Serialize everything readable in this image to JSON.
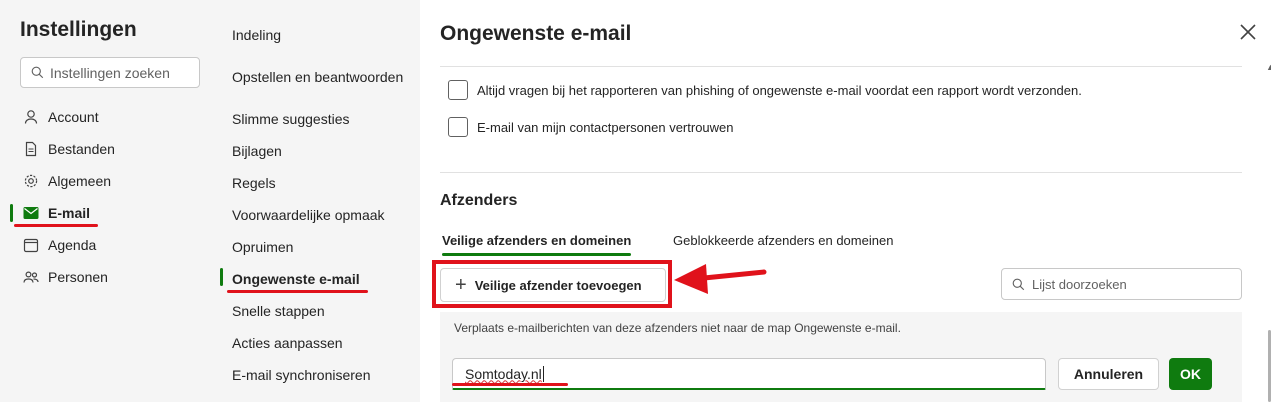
{
  "sidebar": {
    "title": "Instellingen",
    "search_placeholder": "Instellingen zoeken",
    "items": [
      {
        "label": "Account",
        "icon": "person-icon"
      },
      {
        "label": "Bestanden",
        "icon": "document-icon"
      },
      {
        "label": "Algemeen",
        "icon": "gear-icon"
      },
      {
        "label": "E-mail",
        "icon": "mail-icon",
        "active": true
      },
      {
        "label": "Agenda",
        "icon": "calendar-icon"
      },
      {
        "label": "Personen",
        "icon": "people-icon"
      }
    ]
  },
  "subnav": {
    "items": [
      {
        "label": "Indeling"
      },
      {
        "label": "Opstellen en beantwoorden"
      },
      {
        "label": "Slimme suggesties"
      },
      {
        "label": "Bijlagen"
      },
      {
        "label": "Regels"
      },
      {
        "label": "Voorwaardelijke opmaak"
      },
      {
        "label": "Opruimen"
      },
      {
        "label": "Ongewenste e-mail",
        "active": true
      },
      {
        "label": "Snelle stappen"
      },
      {
        "label": "Acties aanpassen"
      },
      {
        "label": "E-mail synchroniseren"
      }
    ]
  },
  "main": {
    "title": "Ongewenste e-mail",
    "checkbox_phishing": "Altijd vragen bij het rapporteren van phishing of ongewenste e-mail voordat een rapport wordt verzonden.",
    "checkbox_contacts": "E-mail van mijn contactpersonen vertrouwen",
    "section_title": "Afzenders",
    "tabs": [
      {
        "label": "Veilige afzenders en domeinen",
        "active": true
      },
      {
        "label": "Geblokkeerde afzenders en domeinen"
      }
    ],
    "add_button": "Veilige afzender toevoegen",
    "list_search_placeholder": "Lijst doorzoeken",
    "info_text": "Verplaats e-mailberichten van deze afzenders niet naar de map Ongewenste e-mail.",
    "input_value": "Somtoday.nl",
    "cancel_label": "Annuleren",
    "ok_label": "OK"
  },
  "colors": {
    "accent": "#0f7b0f",
    "annotation_red": "#e0121b",
    "pane_bg": "#f5f5f5"
  }
}
